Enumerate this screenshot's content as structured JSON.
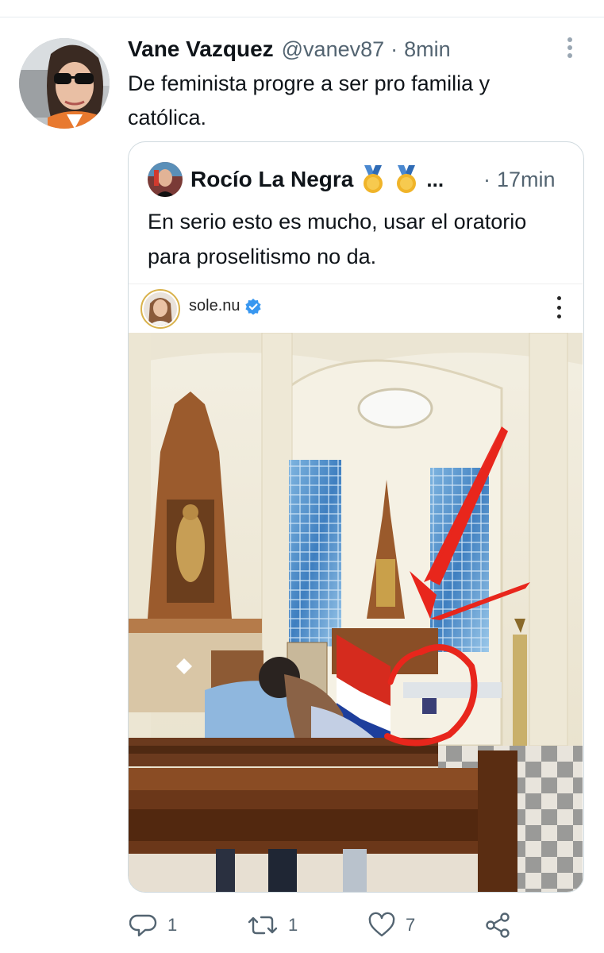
{
  "tweet": {
    "author_name": "Vane Vazquez",
    "handle": "@vanev87",
    "separator": "·",
    "time": "8min",
    "text": "De feminista progre a ser pro familia y católica."
  },
  "quoted_tweet": {
    "author_name": "Rocío La Negra",
    "badges": [
      "medal-icon",
      "medal-icon"
    ],
    "ellipsis": "...",
    "separator": "·",
    "time": "17min",
    "text": "En serio esto es mucho, usar el oratorio para proselitismo no da."
  },
  "instagram_embed": {
    "username": "sole.nu",
    "verified": true
  },
  "actions": {
    "reply_count": "1",
    "retweet_count": "1",
    "like_count": "7"
  },
  "colors": {
    "text_primary": "#0f1419",
    "text_secondary": "#536471",
    "border": "#cfd9de",
    "verified_blue": "#3897f0",
    "annotation_red": "#e8261c"
  }
}
